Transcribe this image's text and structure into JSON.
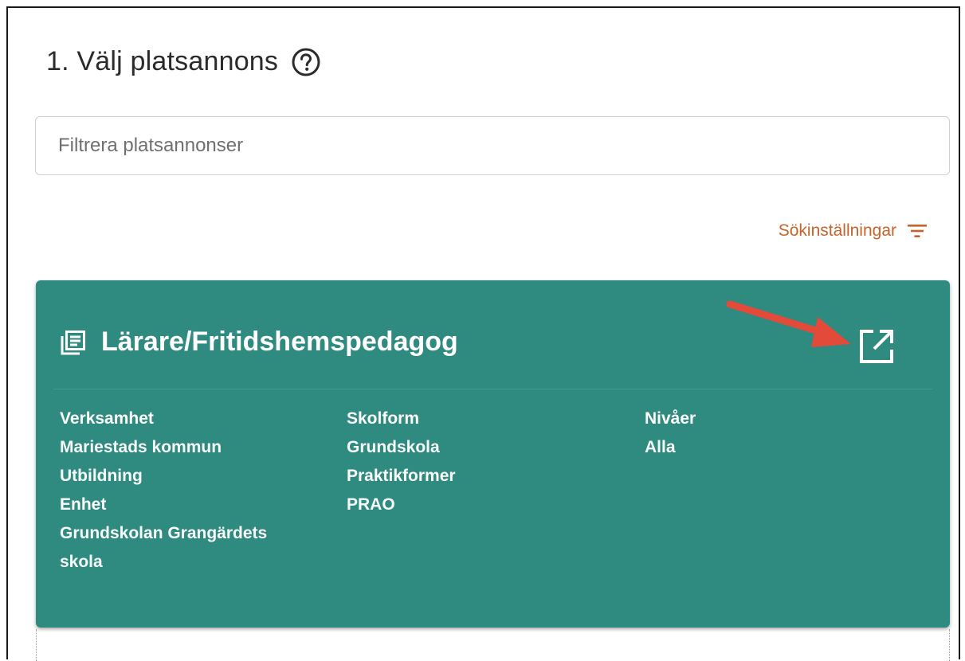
{
  "header": {
    "title": "1. Välj platsannons",
    "help_icon": "help-circle-icon"
  },
  "search": {
    "placeholder": "Filtrera platsannonser",
    "value": ""
  },
  "settings": {
    "label": "Sökinställningar",
    "icon": "filter-list-icon",
    "color": "#c9622a"
  },
  "card": {
    "background_color": "#2f8a80",
    "icon": "article-list-icon",
    "title": "Lärare/Fritidshemspedagog",
    "open_icon": "open-in-new-icon",
    "columns": [
      {
        "fields": [
          {
            "label": "Verksamhet",
            "values": [
              "Mariestads kommun",
              "Utbildning"
            ]
          },
          {
            "label": "Enhet",
            "values": [
              "Grundskolan Grangärdets",
              "skola"
            ]
          }
        ]
      },
      {
        "fields": [
          {
            "label": "Skolform",
            "values": [
              "Grundskola"
            ]
          },
          {
            "label": "Praktikformer",
            "values": [
              "PRAO"
            ]
          }
        ]
      },
      {
        "fields": [
          {
            "label": "Nivåer",
            "values": [
              "Alla"
            ]
          }
        ]
      }
    ]
  },
  "annotation": {
    "arrow_color": "#e34a3a",
    "arrow_icon": "red-arrow-annotation"
  }
}
